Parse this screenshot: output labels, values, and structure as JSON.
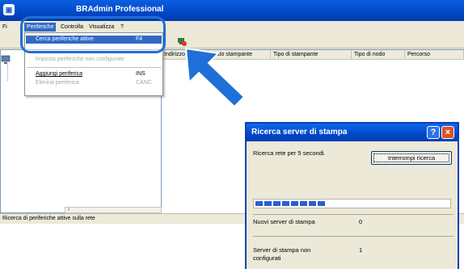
{
  "window": {
    "title": "BRAdmin Professional",
    "menu": [
      "Fi",
      "Periferiche",
      "Controlla",
      "Visualizza",
      "?"
    ],
    "columns": [
      "Indirizzo",
      "Stato stampante",
      "Tipo di stampante",
      "Tipo di nodo",
      "Percorso"
    ],
    "status_text": "Ricerca di periferiche attive sulla rete"
  },
  "dropdown": {
    "items": [
      {
        "label": "Cerca periferiche attive",
        "shortcut": "F4",
        "state": "highlighted"
      },
      {
        "label": "Imposta periferiche non configurate",
        "shortcut": "",
        "state": "disabled"
      },
      {
        "label": "Aggiungi periferica",
        "shortcut": "INS",
        "state": "normal"
      },
      {
        "label": "Elimina periferica",
        "shortcut": "CANC",
        "state": "disabled"
      }
    ]
  },
  "dialog": {
    "title": "Ricerca server di stampa",
    "message": "Ricerca rete per 5 secondi.",
    "stop_button": "Interrompi ricerca",
    "progress_fraction": 0.39,
    "new_servers_label": "Nuovi server di stampa",
    "new_servers_value": "0",
    "unconfigured_label_1": "Server di stampa non",
    "unconfigured_label_2": "configurati",
    "unconfigured_value": "1"
  },
  "colors": {
    "callout": "#1f6fd8",
    "arrow": "#1f6fd8",
    "highlight": "#316ac5",
    "titlebar": "#0a5fe0"
  },
  "icons": {
    "app": "printer-app-icon",
    "toolbar": "network-search-icon",
    "tree": "computer-icon",
    "help": "help-icon",
    "close": "close-icon"
  }
}
